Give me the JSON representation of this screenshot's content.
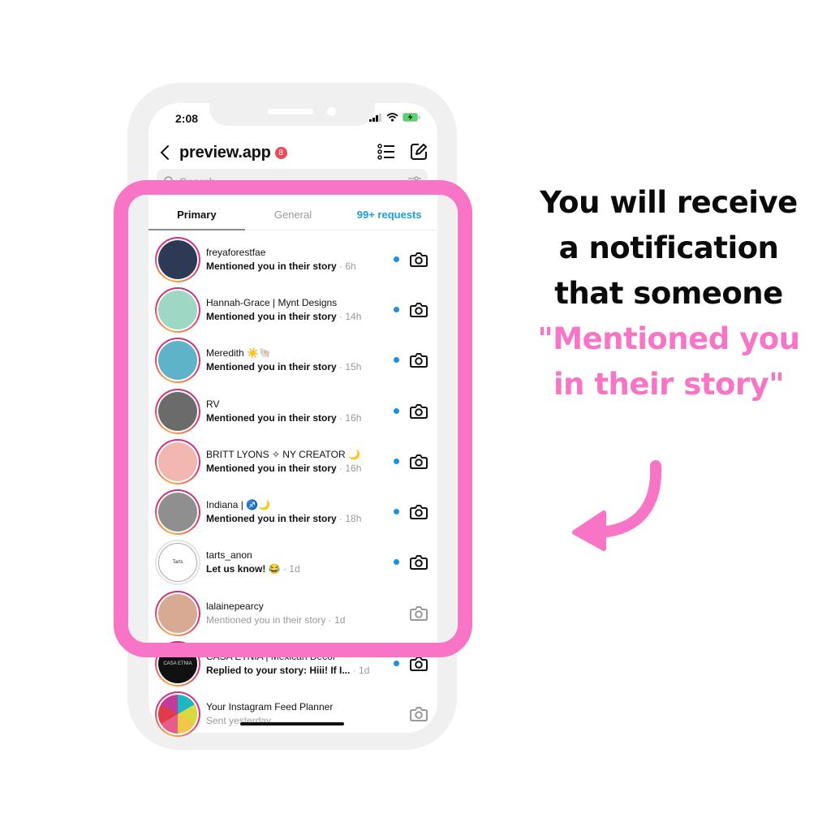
{
  "status_bar": {
    "time": "2:08"
  },
  "header": {
    "back_label": "<",
    "title": "preview.app",
    "badge_count": "8"
  },
  "search": {
    "placeholder": "Search"
  },
  "tabs": [
    {
      "label": "Primary",
      "active": true
    },
    {
      "label": "General",
      "active": false
    },
    {
      "label": "99+ requests",
      "active": false
    }
  ],
  "threads": [
    {
      "name": "freyaforestfae",
      "message": "Mentioned you in their story",
      "time": "· 6h",
      "unread": true,
      "avatar_color": "#2e3a55"
    },
    {
      "name": "Hannah-Grace | Mynt Designs",
      "message": "Mentioned you in their story",
      "time": "· 14h",
      "unread": true,
      "avatar_color": "#9ed8c4"
    },
    {
      "name": "Meredith ☀️🐚",
      "message": "Mentioned you in their story",
      "time": "· 15h",
      "unread": true,
      "avatar_color": "#5fb3c9"
    },
    {
      "name": "RV",
      "message": "Mentioned you in their story",
      "time": "· 16h",
      "unread": true,
      "avatar_color": "#6b6b6b"
    },
    {
      "name": "BRITT LYONS ✧ NY CREATOR 🌙",
      "message": "Mentioned you in their story",
      "time": "· 16h",
      "unread": true,
      "avatar_color": "#f3b7b2"
    },
    {
      "name": "Indiana | ♐🌙",
      "message": "Mentioned you in their story",
      "time": "· 18h",
      "unread": true,
      "avatar_color": "#8f8f8f"
    },
    {
      "name": "tarts_anon",
      "message": "Let us know! 😂",
      "time": "· 1d",
      "unread": true,
      "avatar_color": "#ffffff",
      "avatar_text": "Tarts"
    },
    {
      "name": "lalainepearcy",
      "message": "Mentioned you in their story",
      "time": "· 1d",
      "unread": false,
      "avatar_color": "#d8a993"
    },
    {
      "name": "CASA ETNIA | Mexican Decor",
      "message": "Replied to your story: Hiii! If I...",
      "time": "· 1d",
      "unread": true,
      "avatar_color": "#111111",
      "avatar_text": "CASA ETNIA"
    },
    {
      "name": "Your Instagram Feed Planner",
      "message": "Sent yesterday",
      "time": "",
      "unread": false,
      "avatar_color": "#e94b8a"
    }
  ],
  "caption": {
    "line1": "You will receive",
    "line2": "a notification",
    "line3": "that someone",
    "line4": "\"Mentioned you",
    "line5": "in their story\""
  },
  "colors": {
    "accent_pink": "#f874c6",
    "unread_dot": "#1a8fe3",
    "requests_blue": "#1a9de0",
    "badge_red": "#ed4956"
  }
}
